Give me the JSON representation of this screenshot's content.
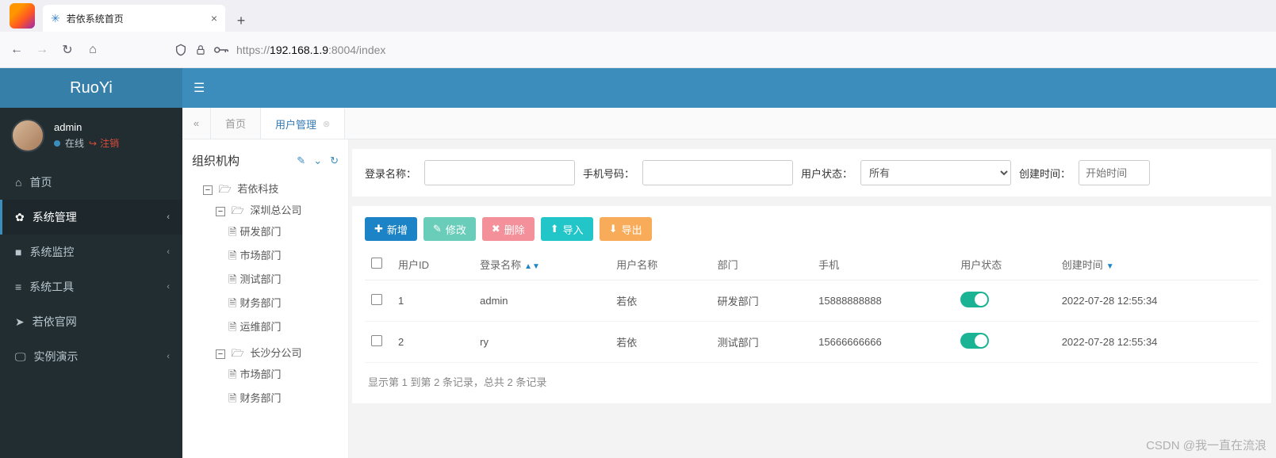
{
  "browser": {
    "tab_title": "若依系统首页",
    "url_prefix": "https://",
    "url_host": "192.168.1.9",
    "url_port": ":8004",
    "url_path": "/index"
  },
  "brand": "RuoYi",
  "user": {
    "name": "admin",
    "status": "在线",
    "logout": "注销"
  },
  "sidebar": [
    {
      "icon": "home",
      "label": "首页"
    },
    {
      "icon": "gear",
      "label": "系统管理",
      "active": true,
      "expand": true
    },
    {
      "icon": "camera",
      "label": "系统监控",
      "expand": true
    },
    {
      "icon": "bars",
      "label": "系统工具",
      "expand": true
    },
    {
      "icon": "send",
      "label": "若依官网"
    },
    {
      "icon": "desktop",
      "label": "实例演示",
      "expand": true
    }
  ],
  "tabs": {
    "home": "首页",
    "active": "用户管理"
  },
  "org": {
    "title": "组织机构",
    "tree": {
      "root": "若依科技",
      "b1": "深圳总公司",
      "b1c": [
        "研发部门",
        "市场部门",
        "测试部门",
        "财务部门",
        "运维部门"
      ],
      "b2": "长沙分公司",
      "b2c": [
        "市场部门",
        "财务部门"
      ]
    }
  },
  "filters": {
    "login_label": "登录名称：",
    "phone_label": "手机号码：",
    "status_label": "用户状态：",
    "status_value": "所有",
    "create_label": "创建时间：",
    "create_placeholder": "开始时间"
  },
  "buttons": {
    "add": "新增",
    "edit": "修改",
    "del": "删除",
    "import": "导入",
    "export": "导出"
  },
  "table": {
    "cols": [
      "用户ID",
      "登录名称",
      "用户名称",
      "部门",
      "手机",
      "用户状态",
      "创建时间"
    ],
    "rows": [
      {
        "id": "1",
        "login": "admin",
        "name": "若依",
        "dept": "研发部门",
        "phone": "15888888888",
        "created": "2022-07-28 12:55:34"
      },
      {
        "id": "2",
        "login": "ry",
        "name": "若依",
        "dept": "测试部门",
        "phone": "15666666666",
        "created": "2022-07-28 12:55:34"
      }
    ],
    "pager": "显示第 1 到第 2 条记录，总共 2 条记录"
  },
  "watermark": "CSDN @我一直在流浪"
}
